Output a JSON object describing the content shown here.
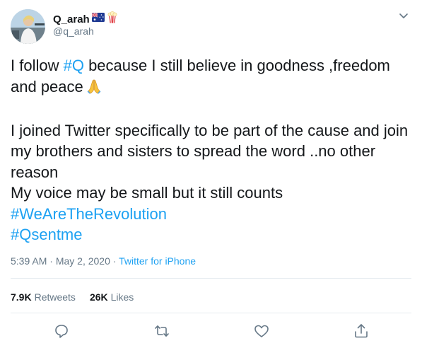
{
  "user": {
    "display_name": "Q_arah",
    "handle": "@q_arah",
    "avatar_icon": "profile-photo",
    "name_emojis": [
      "australia-flag-icon",
      "popcorn-icon"
    ]
  },
  "tweet": {
    "line1_text": "I follow ",
    "line1_hashtag": "#Q",
    "line1_rest": " because I still believe in goodness ,freedom and peace",
    "paragraph2": "I joined Twitter specifically to be part of the cause and join my brothers and sisters to spread the word ..no other reason",
    "paragraph3": "My voice may be small but it still counts",
    "hashtag1": "#WeAreTheRevolution",
    "hashtag2": "#Qsentme",
    "trailing_emoji": "folded-hands-icon"
  },
  "meta": {
    "time": "5:39 AM",
    "separator": "·",
    "date": "May 2, 2020",
    "source": "Twitter for iPhone"
  },
  "stats": {
    "retweets_count": "7.9K",
    "retweets_label": "Retweets",
    "likes_count": "26K",
    "likes_label": "Likes"
  },
  "actions": [
    "reply-icon",
    "retweet-icon",
    "like-icon",
    "share-icon"
  ],
  "colors": {
    "link": "#1da1f2",
    "secondary_text": "#657786",
    "primary_text": "#14171a",
    "divider": "#e6ecf0"
  }
}
